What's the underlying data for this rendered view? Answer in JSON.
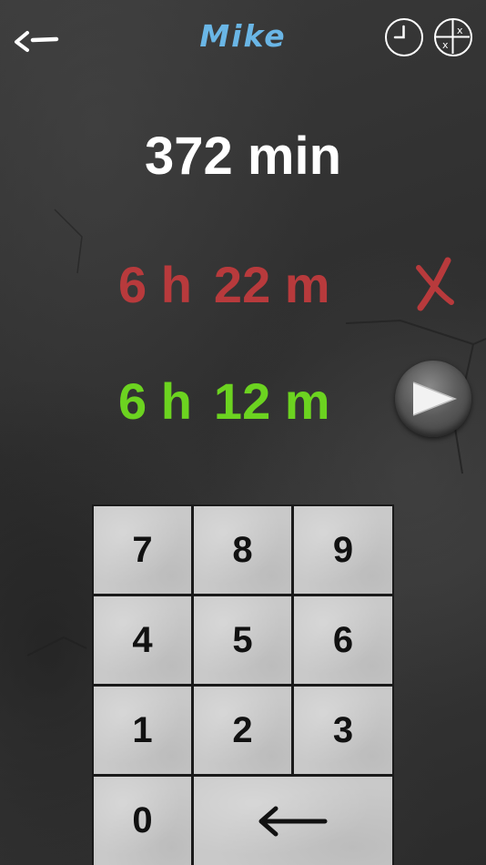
{
  "header": {
    "back_icon": "back-arrow-icon",
    "player_name": "Mike",
    "clock_icon": "clock-icon",
    "grid_icon": "x-grid-icon"
  },
  "question": {
    "total_minutes": "372 min"
  },
  "wrong_answer": {
    "hours": "6 h",
    "minutes": "22 m",
    "color": "#b83a3c",
    "mark_icon": "red-cross-icon"
  },
  "correct_answer": {
    "hours": "6 h",
    "minutes": "12 m",
    "color": "#6cd320"
  },
  "next_button": {
    "icon": "play-triangle-icon"
  },
  "keypad": {
    "keys": [
      "7",
      "8",
      "9",
      "4",
      "5",
      "6",
      "1",
      "2",
      "3",
      "0"
    ],
    "backspace_icon": "left-arrow-icon"
  },
  "colors": {
    "name_blue": "#6ab6e6",
    "background": "#333333",
    "key_gray": "#c9c9c9"
  }
}
